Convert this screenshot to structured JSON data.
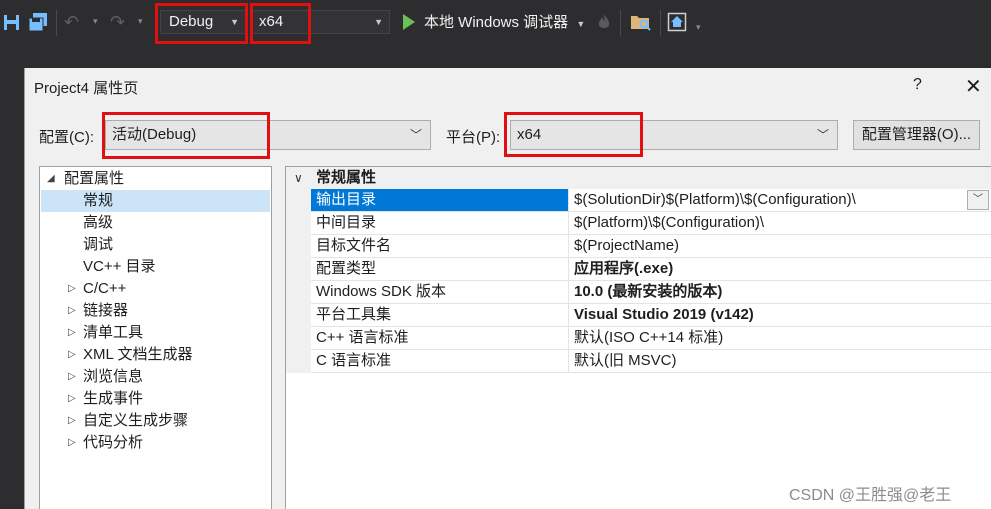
{
  "toolbar": {
    "config_value": "Debug",
    "platform_value": "x64",
    "run_label": "本地 Windows 调试器",
    "icons": [
      "save-icon",
      "save-all-icon",
      "undo-icon",
      "redo-icon",
      "play-icon",
      "fire-icon",
      "folder-search-icon",
      "home-icon"
    ]
  },
  "dialog": {
    "title": "Project4 属性页",
    "help": "?",
    "close": "✕",
    "config_label": "配置(C):",
    "config_value": "活动(Debug)",
    "platform_label": "平台(P):",
    "platform_value": "x64",
    "config_manager_button": "配置管理器(O)..."
  },
  "tree": {
    "items": [
      {
        "label": "配置属性",
        "expander": "◢"
      },
      {
        "label": "常规",
        "expander": ""
      },
      {
        "label": "高级",
        "expander": ""
      },
      {
        "label": "调试",
        "expander": ""
      },
      {
        "label": "VC++ 目录",
        "expander": ""
      },
      {
        "label": "C/C++",
        "expander": "▷"
      },
      {
        "label": "链接器",
        "expander": "▷"
      },
      {
        "label": "清单工具",
        "expander": "▷"
      },
      {
        "label": "XML 文档生成器",
        "expander": "▷"
      },
      {
        "label": "浏览信息",
        "expander": "▷"
      },
      {
        "label": "生成事件",
        "expander": "▷"
      },
      {
        "label": "自定义生成步骤",
        "expander": "▷"
      },
      {
        "label": "代码分析",
        "expander": "▷"
      }
    ]
  },
  "grid": {
    "section": "常规属性",
    "rows": [
      {
        "name": "输出目录",
        "value": "$(SolutionDir)$(Platform)\\$(Configuration)\\"
      },
      {
        "name": "中间目录",
        "value": "$(Platform)\\$(Configuration)\\"
      },
      {
        "name": "目标文件名",
        "value": "$(ProjectName)"
      },
      {
        "name": "配置类型",
        "value": "应用程序(.exe)"
      },
      {
        "name": "Windows SDK 版本",
        "value": "10.0 (最新安装的版本)"
      },
      {
        "name": "平台工具集",
        "value": "Visual Studio 2019 (v142)"
      },
      {
        "name": "C++ 语言标准",
        "value": "默认(ISO C++14 标准)"
      },
      {
        "name": "C 语言标准",
        "value": "默认(旧 MSVC)"
      }
    ]
  },
  "watermark": "CSDN @王胜强@老王",
  "colors": {
    "highlight_red": "#e01010",
    "selection_blue": "#0078d7",
    "tree_selection": "#cce4f7",
    "toolbar_bg": "#2d2d30"
  }
}
